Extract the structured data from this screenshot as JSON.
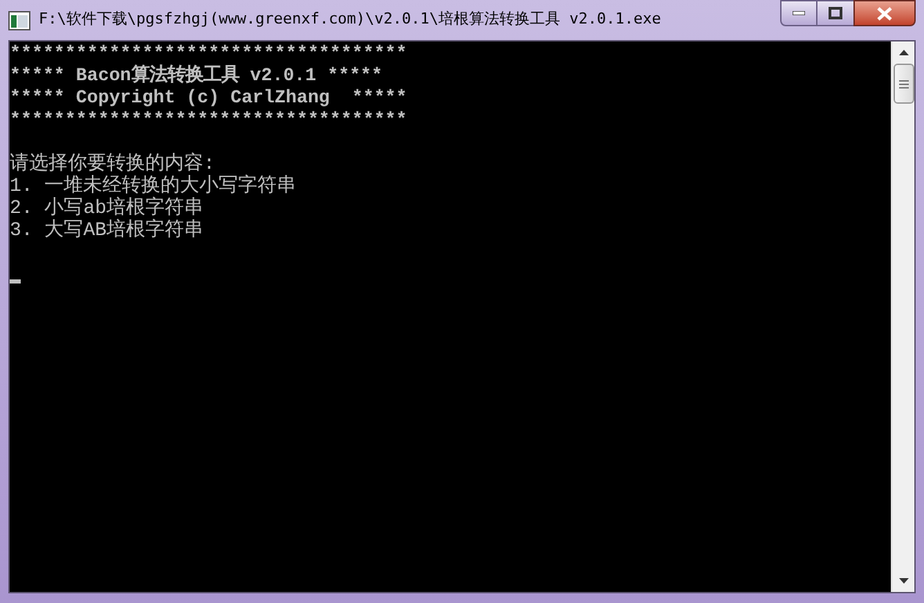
{
  "window": {
    "title": "F:\\软件下载\\pgsfzhgj(www.greenxf.com)\\v2.0.1\\培根算法转换工具 v2.0.1.exe"
  },
  "console": {
    "banner": [
      "************************************",
      "***** Bacon算法转换工具 v2.0.1 *****",
      "***** Copyright (c) CarlZhang  *****",
      "************************************"
    ],
    "menu": [
      "请选择你要转换的内容:",
      "1. 一堆未经转换的大小写字符串",
      "2. 小写ab培根字符串",
      "3. 大写AB培根字符串"
    ],
    "cursor": true
  }
}
